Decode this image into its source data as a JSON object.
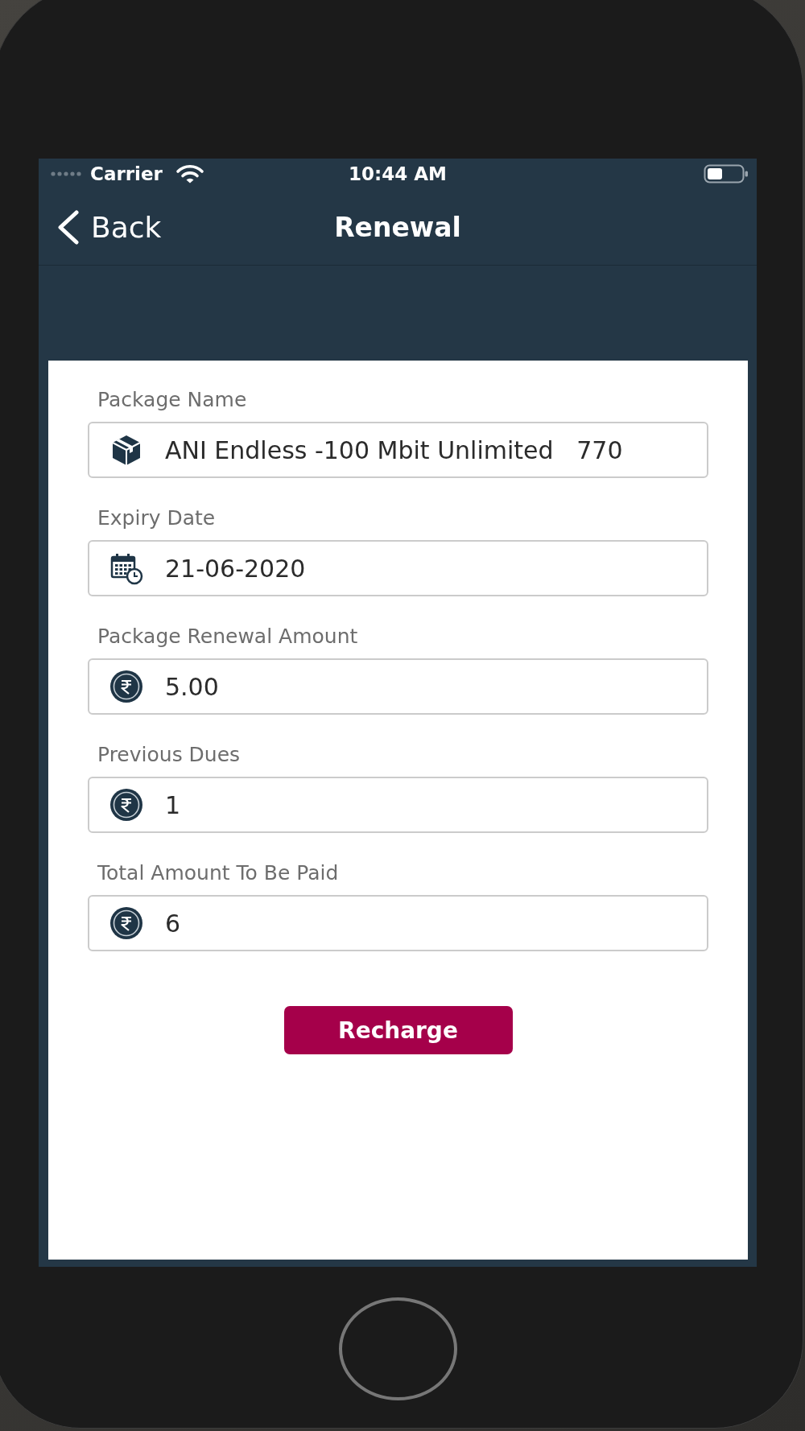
{
  "status_bar": {
    "carrier": "Carrier",
    "time": "10:44 AM"
  },
  "nav_bar": {
    "back": "Back",
    "title": "Renewal"
  },
  "form": {
    "fields": [
      {
        "kind": "package",
        "label": "Package Name",
        "value": "ANI Endless -100 Mbit Unlimited   770"
      },
      {
        "kind": "calendar",
        "label": "Expiry Date",
        "value": "21-06-2020"
      },
      {
        "kind": "currency",
        "label": "Package Renewal Amount",
        "value": "5.00"
      },
      {
        "kind": "currency",
        "label": "Previous Dues",
        "value": "1"
      },
      {
        "kind": "currency",
        "label": "Total Amount To Be Paid",
        "value": "6"
      }
    ]
  },
  "recharge_button": {
    "label": "Recharge"
  }
}
